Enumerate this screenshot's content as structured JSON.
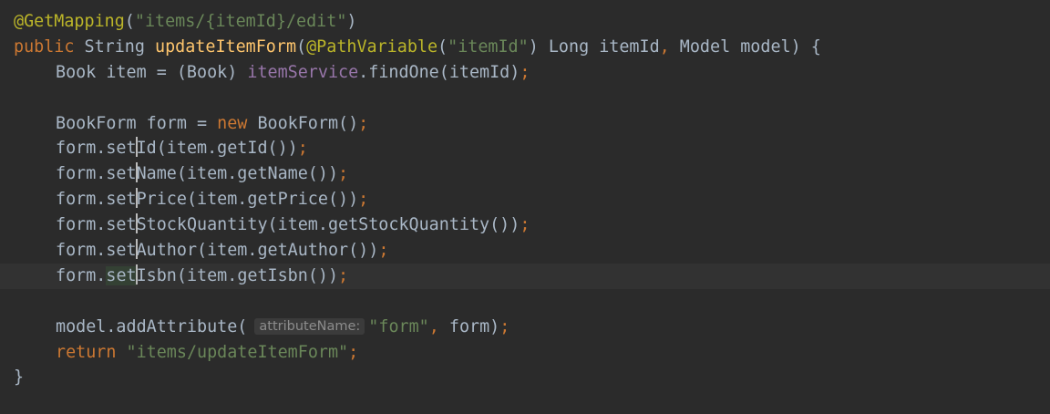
{
  "editor": {
    "colors": {
      "background": "#2b2b2b",
      "annotation": "#bbb529",
      "keyword": "#cc7832",
      "string": "#6a8759",
      "method": "#ffc66d",
      "field": "#9876aa",
      "text": "#a9b7c6",
      "current_line": "#323232"
    },
    "lines": [
      {
        "tokens": [
          {
            "t": "@GetMapping",
            "c": "ann"
          },
          {
            "t": "(",
            "c": "pl"
          },
          {
            "t": "\"items/{itemId}/edit\"",
            "c": "str"
          },
          {
            "t": ")",
            "c": "pl"
          }
        ]
      },
      {
        "tokens": [
          {
            "t": "public",
            "c": "kw"
          },
          {
            "t": " String ",
            "c": "pl"
          },
          {
            "t": "updateItemForm",
            "c": "fn"
          },
          {
            "t": "(",
            "c": "pl"
          },
          {
            "t": "@PathVariable",
            "c": "ann"
          },
          {
            "t": "(",
            "c": "pl"
          },
          {
            "t": "\"itemId\"",
            "c": "str"
          },
          {
            "t": ") Long itemId",
            "c": "pl"
          },
          {
            "t": ",",
            "c": "kw"
          },
          {
            "t": " Model model) {",
            "c": "pl"
          }
        ]
      },
      {
        "indent": 1,
        "tokens": [
          {
            "t": "Book item = (Book) ",
            "c": "pl"
          },
          {
            "t": "itemService",
            "c": "fld"
          },
          {
            "t": ".findOne(itemId)",
            "c": "pl"
          },
          {
            "t": ";",
            "c": "kw"
          }
        ]
      },
      {
        "tokens": []
      },
      {
        "indent": 1,
        "tokens": [
          {
            "t": "BookForm form = ",
            "c": "pl"
          },
          {
            "t": "new",
            "c": "kw"
          },
          {
            "t": " BookForm()",
            "c": "pl"
          },
          {
            "t": ";",
            "c": "kw"
          }
        ]
      },
      {
        "indent": 1,
        "tokens": [
          {
            "t": "form.set",
            "c": "pl"
          },
          {
            "caret": true
          },
          {
            "t": "Id(item.getId())",
            "c": "pl"
          },
          {
            "t": ";",
            "c": "kw"
          }
        ]
      },
      {
        "indent": 1,
        "tokens": [
          {
            "t": "form.set",
            "c": "pl"
          },
          {
            "caret": true
          },
          {
            "t": "Name(item.getName())",
            "c": "pl"
          },
          {
            "t": ";",
            "c": "kw"
          }
        ]
      },
      {
        "indent": 1,
        "tokens": [
          {
            "t": "form.set",
            "c": "pl"
          },
          {
            "caret": true
          },
          {
            "t": "Price(item.getPrice())",
            "c": "pl"
          },
          {
            "t": ";",
            "c": "kw"
          }
        ]
      },
      {
        "indent": 1,
        "tokens": [
          {
            "t": "form.set",
            "c": "pl"
          },
          {
            "caret": true
          },
          {
            "t": "StockQuantity(item.getStockQuantity())",
            "c": "pl"
          },
          {
            "t": ";",
            "c": "kw"
          }
        ]
      },
      {
        "indent": 1,
        "tokens": [
          {
            "t": "form.set",
            "c": "pl"
          },
          {
            "caret": true
          },
          {
            "t": "Author(item.getAuthor())",
            "c": "pl"
          },
          {
            "t": ";",
            "c": "kw"
          }
        ]
      },
      {
        "indent": 1,
        "current": true,
        "tokens": [
          {
            "t": "form.",
            "c": "pl"
          },
          {
            "t": "set",
            "c": "pl",
            "hl": true
          },
          {
            "caret": true
          },
          {
            "t": "Isbn(item.getIsbn())",
            "c": "pl"
          },
          {
            "t": ";",
            "c": "kw"
          }
        ]
      },
      {
        "tokens": []
      },
      {
        "indent": 1,
        "tokens": [
          {
            "t": "model.addAttribute(",
            "c": "pl"
          },
          {
            "t": "attributeName:",
            "c": "hint"
          },
          {
            "t": "\"form\"",
            "c": "str"
          },
          {
            "t": ",",
            "c": "kw"
          },
          {
            "t": " form)",
            "c": "pl"
          },
          {
            "t": ";",
            "c": "kw"
          }
        ]
      },
      {
        "indent": 1,
        "tokens": [
          {
            "t": "return",
            "c": "kw"
          },
          {
            "t": " ",
            "c": "pl"
          },
          {
            "t": "\"items/updateItemForm\"",
            "c": "str"
          },
          {
            "t": ";",
            "c": "kw"
          }
        ]
      },
      {
        "tokens": [
          {
            "t": "}",
            "c": "pl"
          }
        ]
      }
    ]
  }
}
